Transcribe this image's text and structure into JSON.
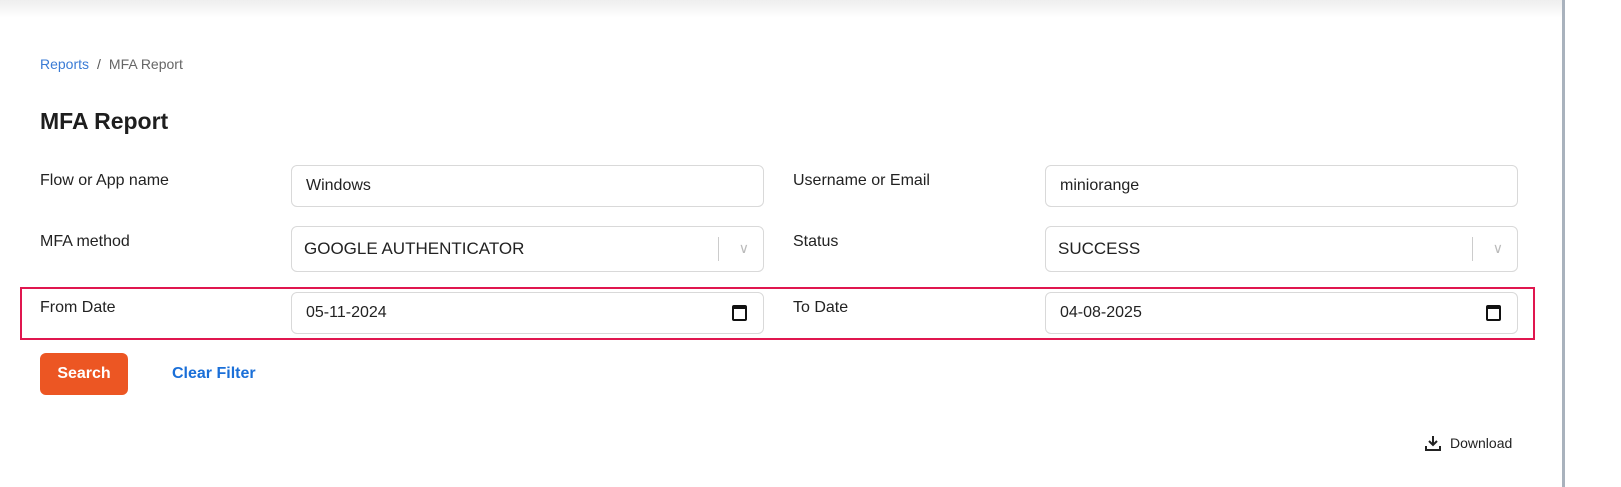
{
  "breadcrumb": {
    "parent": "Reports",
    "separator": "/",
    "current": "MFA Report"
  },
  "title": "MFA Report",
  "filters": {
    "flow_label": "Flow or App name",
    "flow_value": "Windows",
    "user_label": "Username or Email",
    "user_value": "miniorange",
    "method_label": "MFA method",
    "method_value": "GOOGLE AUTHENTICATOR",
    "status_label": "Status",
    "status_value": "SUCCESS",
    "from_label": "From Date",
    "from_value": "05-11-2024",
    "to_label": "To Date",
    "to_value": "04-08-2025"
  },
  "actions": {
    "search": "Search",
    "clear": "Clear Filter",
    "download": "Download"
  },
  "colors": {
    "accent": "#ec5623",
    "link": "#1a6fd8",
    "highlight": "#e0174f"
  }
}
